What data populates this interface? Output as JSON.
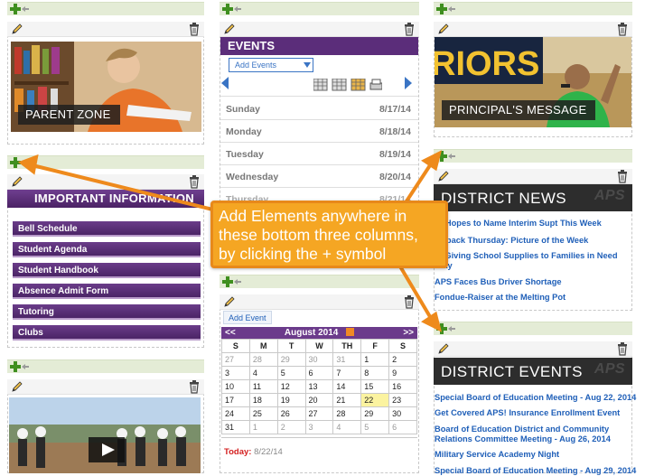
{
  "col1": {
    "parent_zone": "PARENT ZONE",
    "important_title": "IMPORTANT INFORMATION",
    "buttons": [
      "Bell Schedule",
      "Student Agenda",
      "Student Handbook",
      "Absence Admit Form",
      "Tutoring",
      "Clubs"
    ]
  },
  "col2": {
    "events_title": "EVENTS",
    "add_events": "Add Events",
    "events": [
      {
        "day": "Sunday",
        "date": "8/17/14"
      },
      {
        "day": "Monday",
        "date": "8/18/14"
      },
      {
        "day": "Tuesday",
        "date": "8/19/14"
      },
      {
        "day": "Wednesday",
        "date": "8/20/14"
      },
      {
        "day": "Thursday",
        "date": "8/21/14"
      }
    ],
    "add_event": "Add Event",
    "calendar": {
      "prev": "<<",
      "next": ">>",
      "month": "August 2014",
      "weekdays": [
        "S",
        "M",
        "T",
        "W",
        "TH",
        "F",
        "S"
      ],
      "weeks": [
        [
          "27",
          "28",
          "29",
          "30",
          "31",
          "1",
          "2"
        ],
        [
          "3",
          "4",
          "5",
          "6",
          "7",
          "8",
          "9"
        ],
        [
          "10",
          "11",
          "12",
          "13",
          "14",
          "15",
          "16"
        ],
        [
          "17",
          "18",
          "19",
          "20",
          "21",
          "22",
          "23"
        ],
        [
          "24",
          "25",
          "26",
          "27",
          "28",
          "29",
          "30"
        ],
        [
          "31",
          "1",
          "2",
          "3",
          "4",
          "5",
          "6"
        ]
      ],
      "today_label": "Today:",
      "today_value": "8/22/14"
    }
  },
  "col3": {
    "principal": "PRINCIPAL'S MESSAGE",
    "banner_text": "RIORS",
    "news_title": "DISTRICT NEWS",
    "news": [
      "rd Hopes to Name Interim Supt This Week",
      "owback Thursday: Picture of the Week",
      "re Giving School Supplies to Families in Need",
      "rday",
      "APS Faces Bus Driver Shortage",
      "Fondue-Raiser at the Melting Pot"
    ],
    "events_title": "DISTRICT EVENTS",
    "events": [
      "Special Board of Education Meeting - Aug 22, 2014",
      "Get Covered APS! Insurance Enrollment Event",
      "Board of Education District and Community",
      "Relations Committee Meeting - Aug 26, 2014",
      "Military Service Academy Night",
      "Special Board of Education Meeting - Aug 29, 2014"
    ],
    "aps_mark": "APS"
  },
  "callout": {
    "lines": [
      "Add Elements anywhere in",
      "these bottom three columns,",
      "by clicking the + symbol"
    ]
  },
  "colors": {
    "purple": "#5b2d7a",
    "orange": "#f5a623",
    "link_blue": "#1f5fb8",
    "add_bar": "#e4ecd6"
  },
  "icons": [
    "plus-icon",
    "pencil-icon",
    "trash-icon",
    "calendar-view-icon",
    "print-icon",
    "rss-icon",
    "play-icon"
  ]
}
